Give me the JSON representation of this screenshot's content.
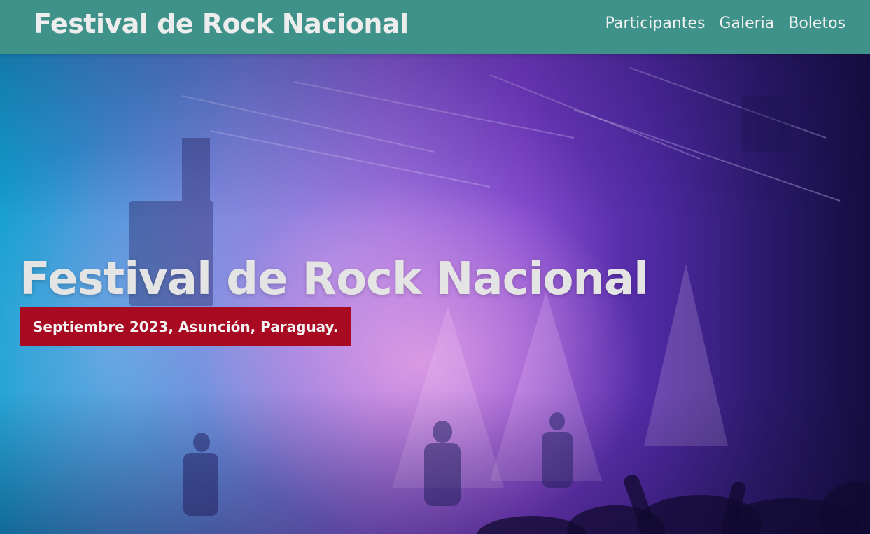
{
  "header": {
    "site_title": "Festival de Rock Nacional",
    "nav": [
      {
        "label": "Participantes"
      },
      {
        "label": "Galeria"
      },
      {
        "label": "Boletos"
      }
    ]
  },
  "hero": {
    "title": "Festival de Rock Nacional",
    "subtitle": "Septiembre 2023, Asunción, Paraguay.",
    "background": "concert-stage-photo"
  },
  "colors": {
    "header_bg": "#3e928a",
    "badge_bg": "#a80a22",
    "text_light": "#e4e4e4"
  }
}
